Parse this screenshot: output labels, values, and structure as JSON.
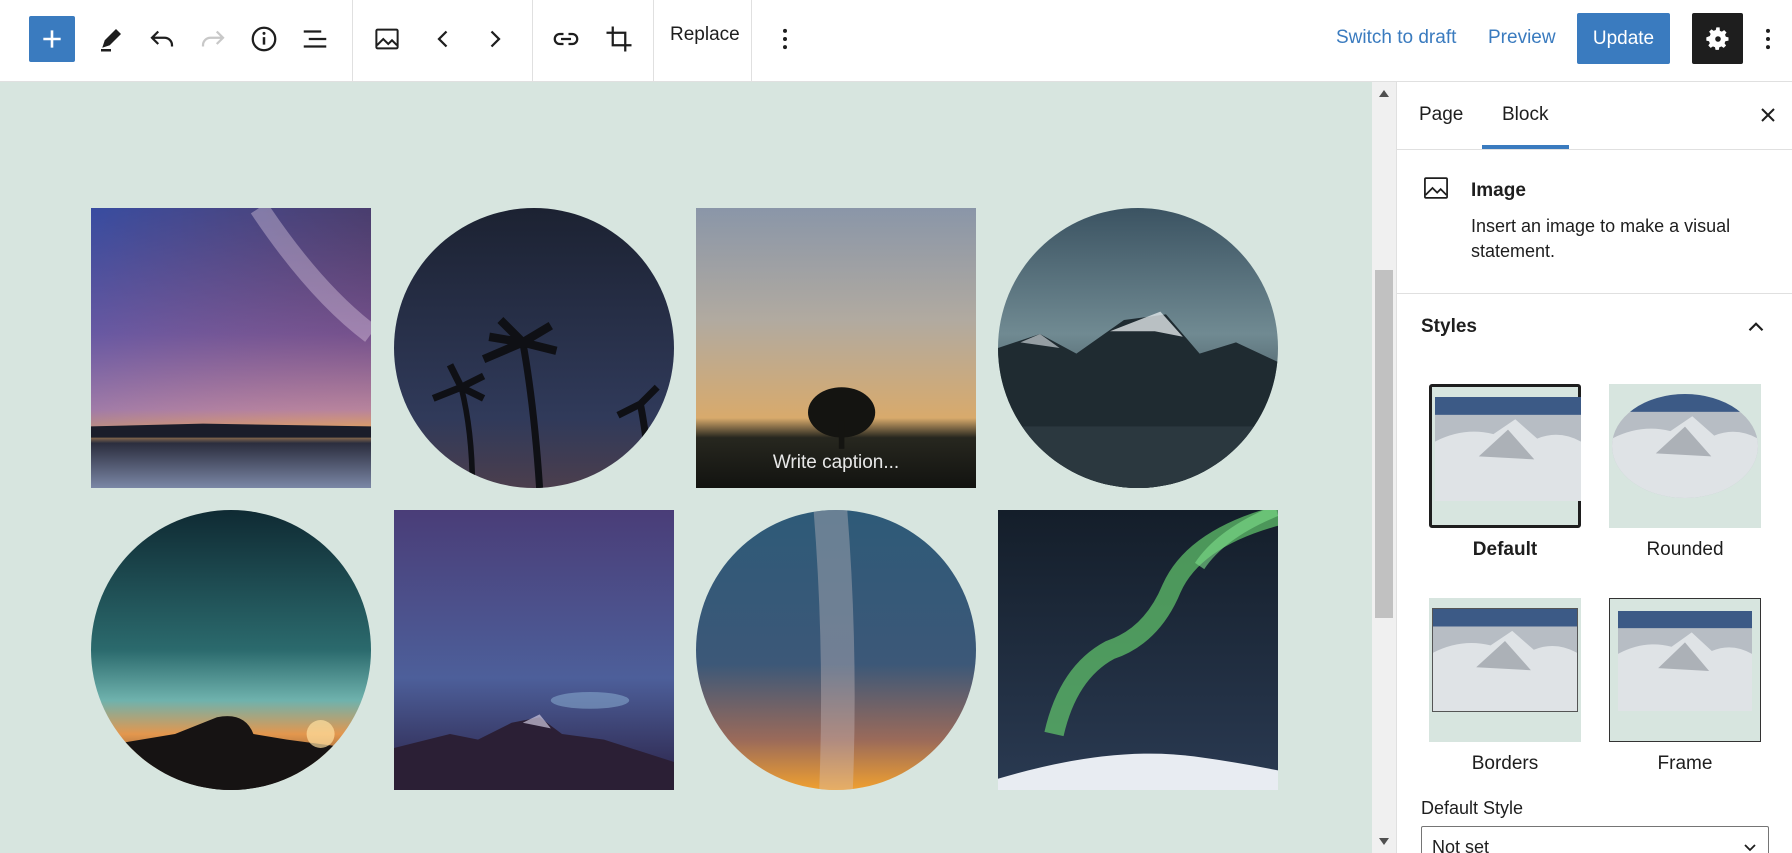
{
  "toolbar": {
    "replace_label": "Replace",
    "switch_to_draft_label": "Switch to draft",
    "preview_label": "Preview",
    "update_label": "Update",
    "icons": [
      "plus-icon",
      "pen-icon",
      "undo-icon",
      "redo-icon",
      "info-icon",
      "list-view-icon",
      "image-icon",
      "chevron-left-icon",
      "chevron-right-icon",
      "link-icon",
      "crop-icon",
      "more-vertical-icon",
      "gear-icon"
    ]
  },
  "canvas": {
    "caption_placeholder": "Write caption..."
  },
  "sidebar": {
    "tabs": [
      {
        "label": "Page",
        "active": false
      },
      {
        "label": "Block",
        "active": true
      }
    ],
    "block": {
      "title": "Image",
      "description": "Insert an image to make a visual statement."
    },
    "styles": {
      "title": "Styles",
      "options": [
        {
          "label": "Default",
          "active": true
        },
        {
          "label": "Rounded",
          "active": false
        },
        {
          "label": "Borders",
          "active": false
        },
        {
          "label": "Frame",
          "active": false
        }
      ]
    },
    "default_style": {
      "label": "Default Style",
      "value": "Not set"
    }
  },
  "colors": {
    "accent": "#3a7bbf",
    "canvas_bg": "#d7e5df",
    "dark": "#1e1e1e"
  }
}
